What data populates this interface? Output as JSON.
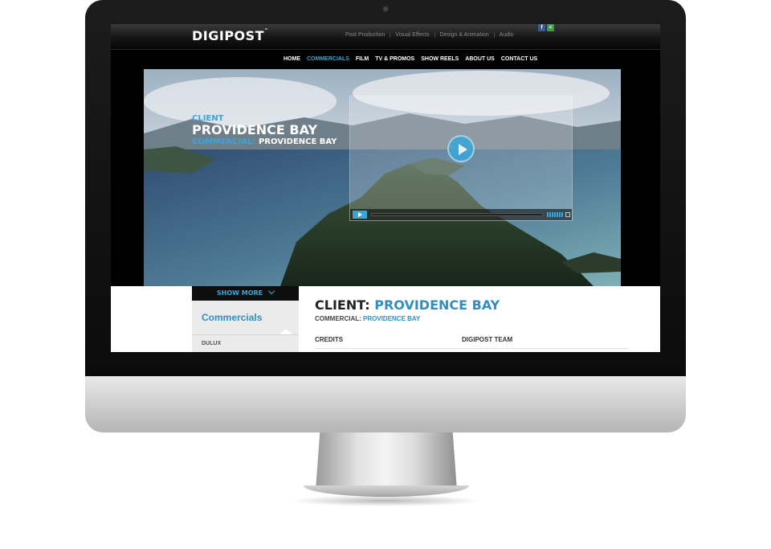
{
  "header": {
    "logo": "DIGIPOST",
    "logo_mark": "™",
    "services": [
      "Post Production",
      "Visual Effects",
      "Design & Animation",
      "Audio"
    ],
    "social": {
      "facebook": "f",
      "share": "<"
    }
  },
  "nav": {
    "items": [
      {
        "label": "HOME"
      },
      {
        "label": "COMMERCIALS"
      },
      {
        "label": "FILM"
      },
      {
        "label": "TV & PROMOS"
      },
      {
        "label": "SHOW REELS"
      },
      {
        "label": "ABOUT US"
      },
      {
        "label": "CONTACT US"
      }
    ],
    "active_index": 1
  },
  "hero": {
    "client_label": "CLIENT",
    "client_name": "PROVIDENCE BAY",
    "commercial_label": "COMMERCIAL:",
    "commercial_value": "PROVIDENCE BAY"
  },
  "sidebar": {
    "show_more": "SHOW MORE",
    "category": "Commercials",
    "items": [
      "DULUX"
    ]
  },
  "content": {
    "title_label": "CLIENT:",
    "title_value": "PROVIDENCE BAY",
    "sub_label": "COMMERCIAL:",
    "sub_value": "PROVIDENCE BAY",
    "credits": "CREDITS",
    "team": "DIGIPOST TEAM"
  },
  "colors": {
    "accent": "#3aa6d8",
    "nav_bg": "#000000",
    "sidebar_bg": "#ebebeb"
  }
}
